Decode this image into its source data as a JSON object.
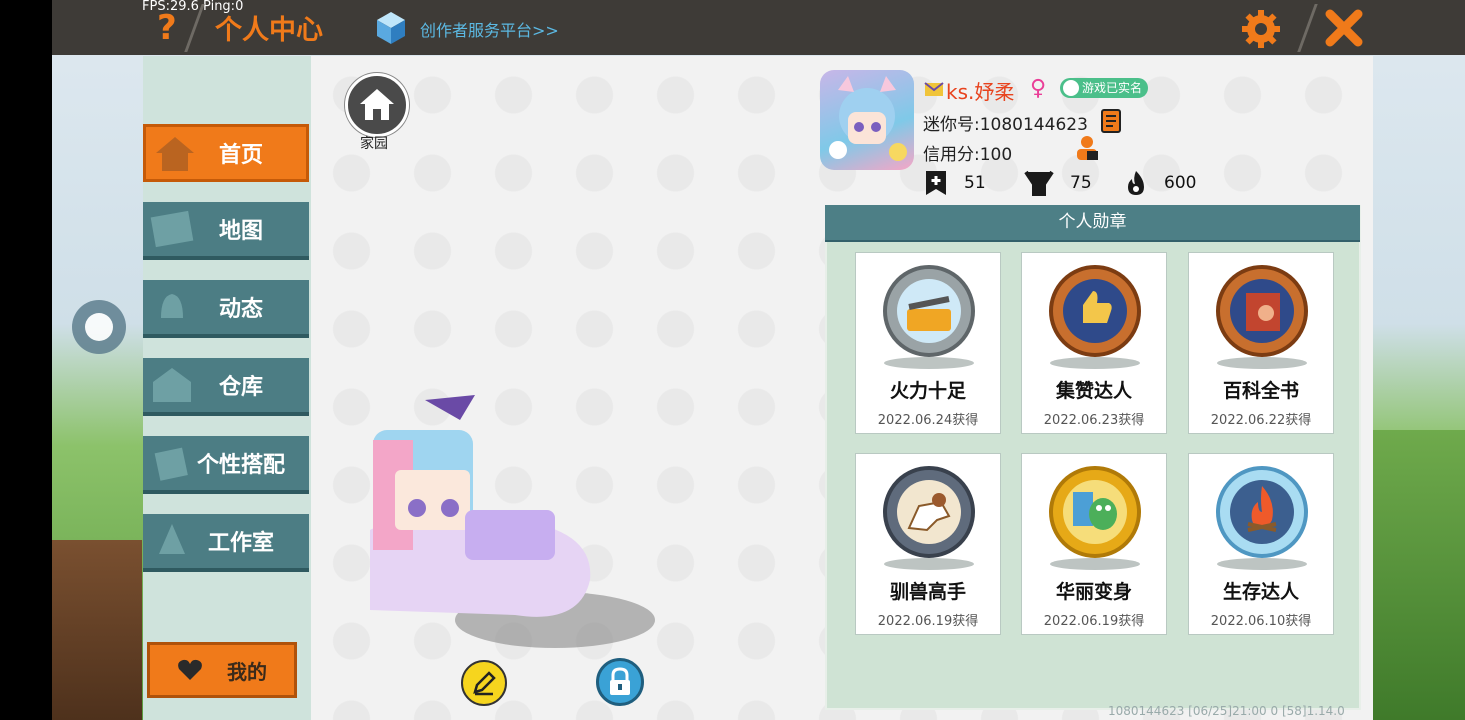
{
  "hud": {
    "fps_ping": "FPS:29.6  Ping:0"
  },
  "header": {
    "title": "个人中心",
    "creator_link": "创作者服务平台>>",
    "help_icon": "question-mark-icon",
    "settings_icon": "gear-icon",
    "close_icon": "close-x-icon",
    "accent": "#f07a1a"
  },
  "sidebar": {
    "items": [
      {
        "label": "首页",
        "icon": "house-icon",
        "active": true
      },
      {
        "label": "地图",
        "icon": "image-icon",
        "active": false
      },
      {
        "label": "动态",
        "icon": "bell-icon",
        "active": false
      },
      {
        "label": "仓库",
        "icon": "warehouse-icon",
        "active": false
      },
      {
        "label": "个性搭配",
        "icon": "outfit-icon",
        "active": false
      },
      {
        "label": "工作室",
        "icon": "tree-icon",
        "active": false
      }
    ],
    "mine_label": "我的",
    "mine_icon": "heart-icon"
  },
  "home": {
    "label": "家园"
  },
  "profile": {
    "name": "ks.妤柔",
    "gender_symbol": "♀",
    "verified_label": "游戏已实名",
    "mini_id": "迷你号:1080144623",
    "credit": "信用分:100",
    "stats": [
      {
        "icon": "plus-bookmark-icon",
        "value": "51"
      },
      {
        "icon": "cheer-person-icon",
        "value": "75"
      },
      {
        "icon": "flame-icon",
        "value": "600"
      }
    ]
  },
  "badges": {
    "title": "个人勋章",
    "items": [
      {
        "name": "火力十足",
        "date": "2022.06.24获得",
        "rim": "silver"
      },
      {
        "name": "集赞达人",
        "date": "2022.06.23获得",
        "rim": "bronze"
      },
      {
        "name": "百科全书",
        "date": "2022.06.22获得",
        "rim": "bronze"
      },
      {
        "name": "驯兽高手",
        "date": "2022.06.19获得",
        "rim": "steel"
      },
      {
        "name": "华丽变身",
        "date": "2022.06.19获得",
        "rim": "gold"
      },
      {
        "name": "生存达人",
        "date": "2022.06.10获得",
        "rim": "ice"
      }
    ]
  },
  "footer": {
    "text": "1080144623   [06/25]21:00 0  [58]1.14.0"
  }
}
